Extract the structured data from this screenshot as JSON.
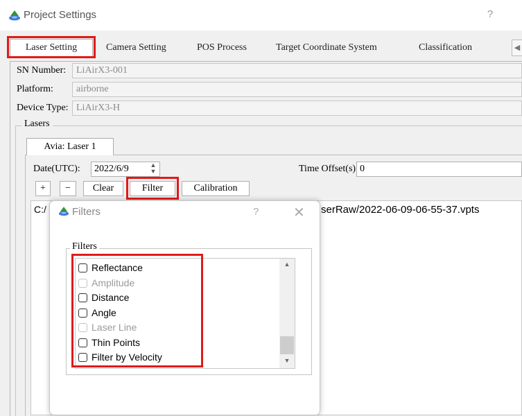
{
  "window": {
    "title": "Project Settings",
    "help": "?"
  },
  "tabs": [
    {
      "label": "Laser Setting",
      "active": true
    },
    {
      "label": "Camera Setting"
    },
    {
      "label": "POS Process"
    },
    {
      "label": "Target Coordinate System"
    },
    {
      "label": "Classification"
    }
  ],
  "tab_scroll_icon": "◀",
  "device": {
    "sn_label": "SN Number:",
    "sn_value": "LiAirX3-001",
    "platform_label": "Platform:",
    "platform_value": "airborne",
    "device_type_label": "Device Type:",
    "device_type_value": "LiAirX3-H"
  },
  "lasers": {
    "group_label": "Lasers",
    "laser_tab": "Avia: Laser 1",
    "date_label": "Date(UTC):",
    "date_value": "2022/6/9",
    "offset_label": "Time Offset(s):",
    "offset_value": "0",
    "buttons": {
      "add": "+",
      "remove": "−",
      "clear": "Clear",
      "filter": "Filter",
      "calibration": "Calibration"
    },
    "path_start": "C:/",
    "path_end": "serRaw/2022-06-09-06-55-37.vpts"
  },
  "filters_dialog": {
    "title": "Filters",
    "help": "?",
    "close": "✕",
    "group_label": "Filters",
    "items": [
      {
        "label": "Reflectance",
        "enabled": true
      },
      {
        "label": "Amplitude",
        "enabled": false
      },
      {
        "label": "Distance",
        "enabled": true
      },
      {
        "label": "Angle",
        "enabled": true
      },
      {
        "label": "Laser Line",
        "enabled": false
      },
      {
        "label": "Thin Points",
        "enabled": true
      },
      {
        "label": "Filter by Velocity",
        "enabled": true
      }
    ]
  },
  "colors": {
    "highlight": "#e01a1a",
    "icon_green": "#3a8f3a",
    "icon_blue": "#3b7ad9"
  }
}
